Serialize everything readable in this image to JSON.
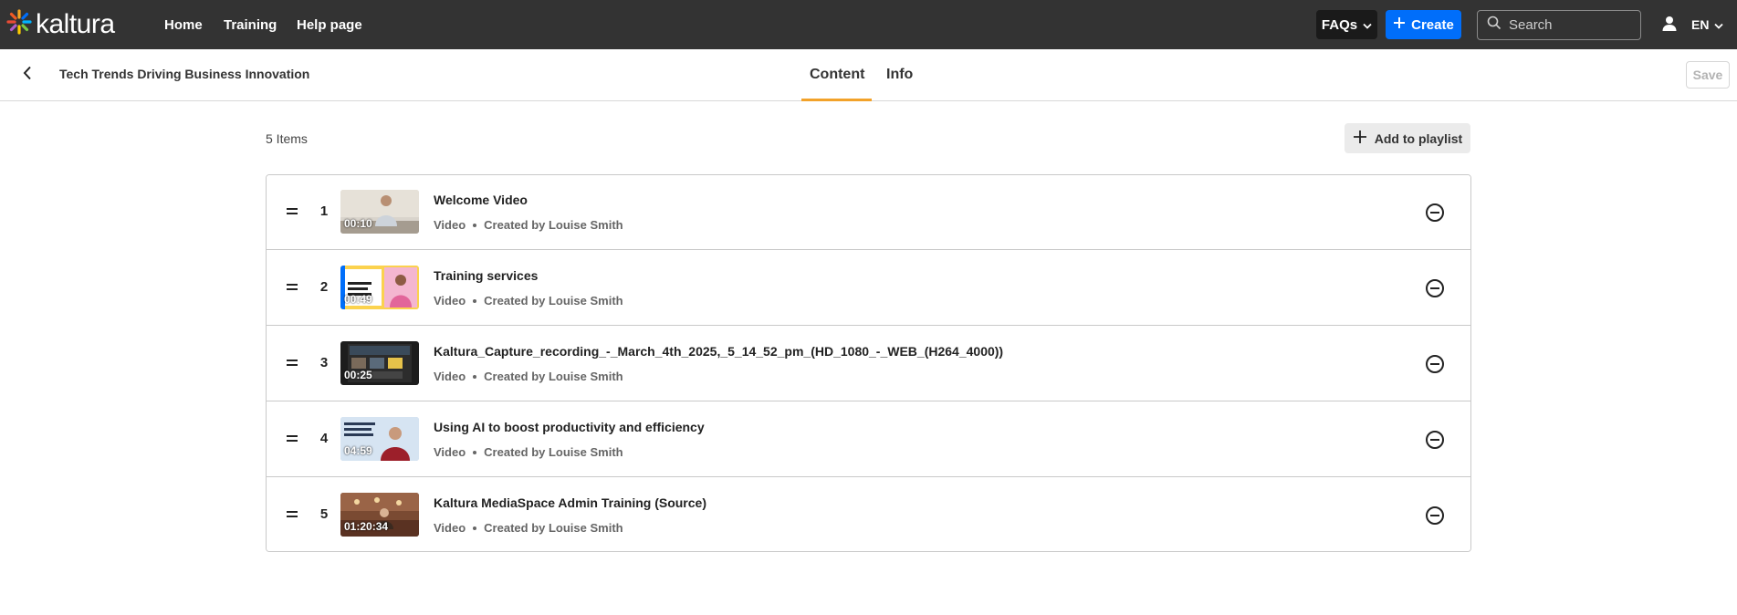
{
  "header": {
    "logo_text": "kaltura",
    "nav": [
      "Home",
      "Training",
      "Help page"
    ],
    "faqs_label": "FAQs",
    "create_label": "Create",
    "search_placeholder": "Search",
    "language": "EN"
  },
  "subheader": {
    "title": "Tech Trends Driving Business Innovation",
    "tabs": [
      "Content",
      "Info"
    ],
    "active_tab": "Content",
    "save_label": "Save"
  },
  "content": {
    "items_count": "5 Items",
    "add_label": "Add to playlist",
    "items": [
      {
        "num": "1",
        "title": "Welcome Video",
        "type": "Video",
        "creator": "Created by Louise Smith",
        "duration": "00:10"
      },
      {
        "num": "2",
        "title": "Training services",
        "type": "Video",
        "creator": "Created by Louise Smith",
        "duration": "00:49"
      },
      {
        "num": "3",
        "title": "Kaltura_Capture_recording_-_March_4th_2025,_5_14_52_pm_(HD_1080_-_WEB_(H264_4000))",
        "type": "Video",
        "creator": "Created by Louise Smith",
        "duration": "00:25"
      },
      {
        "num": "4",
        "title": "Using AI to boost productivity and efficiency",
        "type": "Video",
        "creator": "Created by Louise Smith",
        "duration": "04:59"
      },
      {
        "num": "5",
        "title": "Kaltura MediaSpace Admin Training (Source)",
        "type": "Video",
        "creator": "Created by Louise Smith",
        "duration": "01:20:34"
      }
    ]
  },
  "colors": {
    "topbar": "#333333",
    "create_accent": "#006efa",
    "tab_underline": "#f2a22a"
  },
  "icons": [
    "kaltura-logo-icon",
    "chevron-down-icon",
    "plus-icon",
    "search-icon",
    "user-icon",
    "back-arrow-icon",
    "drag-handle-icon",
    "remove-circle-icon"
  ]
}
